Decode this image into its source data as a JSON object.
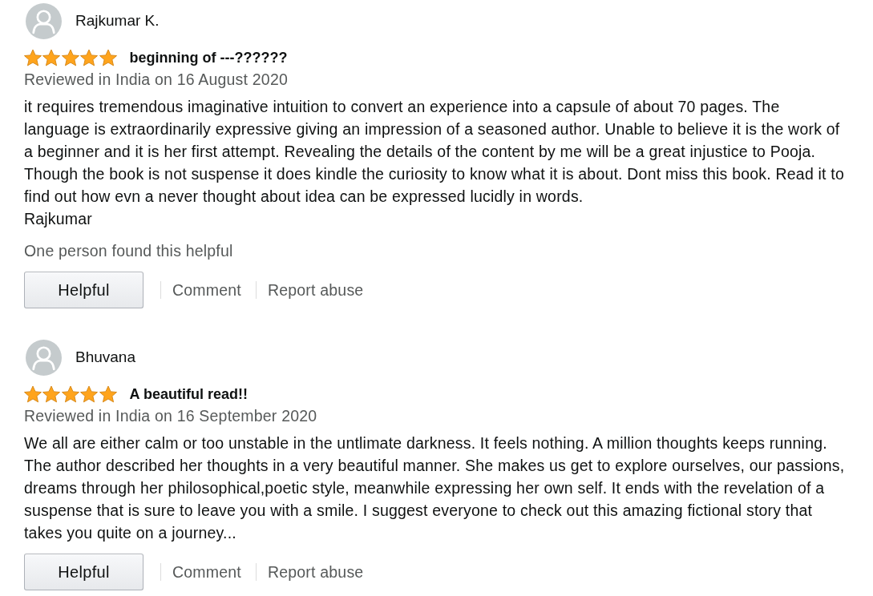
{
  "reviews": [
    {
      "reviewer": "Rajkumar K.",
      "stars": 5,
      "title": "beginning of ---??????",
      "date": "Reviewed in India on 16 August 2020",
      "body": [
        "it requires tremendous imaginative intuition to convert an experience into a capsule of about 70 pages. The language is extraordinarily expressive giving an impression of a seasoned author. Unable to believe it is the work of a beginner and it is her first attempt. Revealing the details of the content by me will be a great injustice to Pooja. Though the book is not suspense it does kindle the curiosity to know what it is about. Dont miss this book. Read it to find out how evn a never thought about idea can be expressed lucidly in words.",
        "Rajkumar"
      ],
      "helpful_count": "One person found this helpful",
      "helpful_button": "Helpful",
      "links": [
        "Comment",
        "Report abuse"
      ]
    },
    {
      "reviewer": "Bhuvana",
      "stars": 5,
      "title": "A beautiful read!!",
      "date": "Reviewed in India on 16 September 2020",
      "body": [
        "We all are either calm or too unstable in the untlimate darkness. It feels nothing. A million thoughts keeps running. The author described her thoughts in a very beautiful manner. She makes us get to explore ourselves, our passions, dreams through her philosophical,poetic style, meanwhile expressing her own self. It ends with the revelation of a suspense that is sure to leave you with a smile. I suggest everyone to check out this amazing fictional story that takes you quite on a journey..."
      ],
      "helpful_button": "Helpful",
      "links": [
        "Comment",
        "Report abuse"
      ]
    }
  ]
}
